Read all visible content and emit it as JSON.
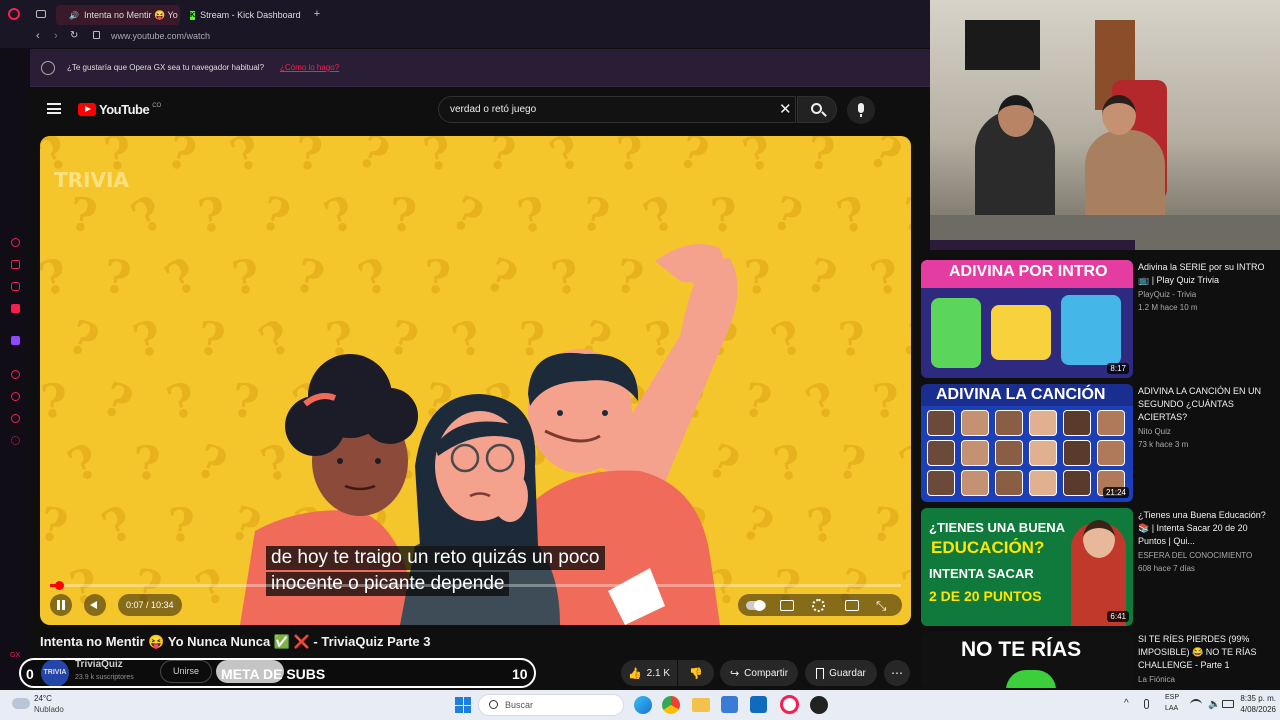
{
  "browser": {
    "tabs": [
      {
        "label": "Intenta no Mentir 😝 Yo",
        "active": true
      },
      {
        "label": "Stream - Kick Dashboard",
        "active": false
      }
    ],
    "url": "www.youtube.com/watch",
    "banner_text": "¿Te gustaría que Opera GX sea tu navegador habitual?",
    "banner_link": "¿Cómo lo hago?"
  },
  "youtube": {
    "logo_text": "YouTube",
    "logo_region": "CO",
    "search_value": "verdad o retó juego"
  },
  "video": {
    "watermark": "TRIVIA",
    "caption_line1": "de hoy te traigo un reto quizás un poco",
    "caption_line2": "inocente o picante depende",
    "time": "0:07 / 10:34",
    "progress_fraction": 0.011,
    "title": "Intenta no Mentir 😝 Yo Nunca Nunca ✅ ❌ - TriviaQuiz Parte 3"
  },
  "channel": {
    "name": "TriviaQuiz",
    "subs": "23.9 k suscriptores",
    "avatar_text": "TRIVIA",
    "join_label": "Unirse"
  },
  "overlay": {
    "left_num": "0",
    "label": "META DE SUBS",
    "right_num": "10"
  },
  "actions": {
    "likes": "2.1 K",
    "share": "Compartir",
    "save": "Guardar"
  },
  "recommendations": [
    {
      "title": "Adivina la SERIE por su INTRO 📺 | Play Quiz Trivia",
      "channel": "PlayQuiz - Trivia",
      "meta": "1.2 M   hace 10 m",
      "duration": "8:17",
      "thumb_text": "ADIVINA POR INTRO"
    },
    {
      "title": "ADIVINA LA CANCIÓN EN UN SEGUNDO ¿CUÁNTAS ACIERTAS?",
      "channel": "Nito Quiz",
      "meta": "73 k   hace 3 m",
      "duration": "21:24",
      "thumb_text": "ADIVINA LA CANCIÓN"
    },
    {
      "title": "¿Tienes una Buena Educación? 📚 | Intenta Sacar 20 de 20 Puntos | Qui...",
      "channel": "ESFERA DEL CONOCIMIENTO",
      "meta": "608   hace 7 días",
      "duration": "6:41",
      "thumb_line1": "¿TIENES UNA BUENA",
      "thumb_line2": "EDUCACIÓN?",
      "thumb_line3": "INTENTA SACAR",
      "thumb_line4": "2 DE 20 PUNTOS"
    },
    {
      "title": "SI TE RÍES PIERDES (99% IMPOSIBLE) 😂 NO TE RÍAS CHALLENGE - Parte 1",
      "channel": "La Fiónica",
      "meta": "",
      "duration": "",
      "thumb_text": "NO TE RÍAS"
    }
  ],
  "taskbar": {
    "temp": "24°C",
    "weather": "Nublado",
    "search": "Buscar",
    "lang1": "ESP",
    "lang2": "LAA",
    "time": "8:35 p. m.",
    "date": "4/08/2026"
  },
  "colors": {
    "video_bg": "#f5c52c",
    "yt_red": "#ff0000",
    "accent_opera": "#fa1e4e"
  }
}
